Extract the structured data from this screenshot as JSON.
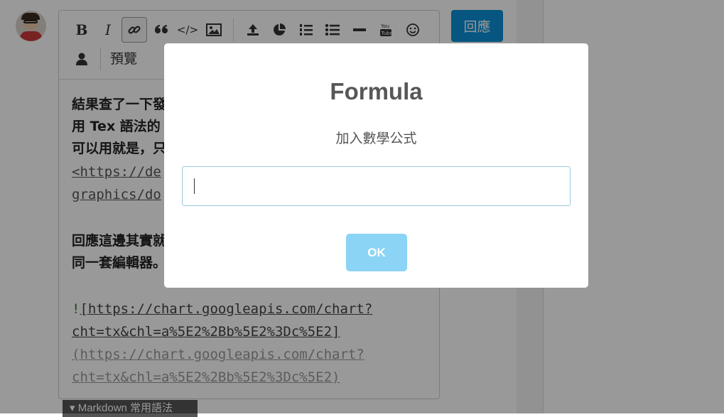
{
  "editor": {
    "toolbar": {
      "bold": "B",
      "italic": "I",
      "code": "</>",
      "preview_label": "預覽"
    },
    "content_lines": {
      "l1": "結果查了一下發",
      "l2": "用 Tex 語法的",
      "l3": "可以用就是，只",
      "l4": "<https://de",
      "l5": "graphics/do",
      "l6": "回應這邊其實就",
      "l7": "同一套編輯器。",
      "l8_bang": "!",
      "l8": "[https://chart.googleapis.com/chart?",
      "l9": "cht=tx&chl=a%5E2%2Bb%5E2%3Dc%5E2]",
      "l10": "(https://chart.googleapis.com/chart?",
      "l11": "cht=tx&chl=a%5E2%2Bb%5E2%3Dc%5E2)"
    },
    "markdown_tab": "▾ Markdown 常用語法"
  },
  "reply_button": "回應",
  "modal": {
    "title": "Formula",
    "subtitle": "加入數學公式",
    "input_value": "",
    "ok_label": "OK"
  },
  "colors": {
    "reply_button": "#0a8fd8",
    "ok_button": "#8cd4f5",
    "input_border": "#9ac8dd"
  }
}
